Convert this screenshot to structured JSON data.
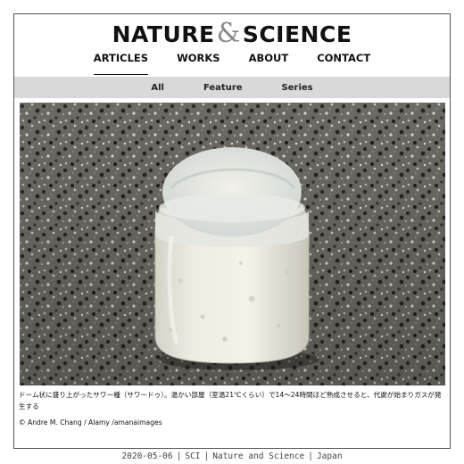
{
  "brand": {
    "left": "NATURE",
    "amp": "&",
    "right": "SCIENCE"
  },
  "main_nav": {
    "items": [
      {
        "label": "ARTICLES",
        "active": true
      },
      {
        "label": "WORKS",
        "active": false
      },
      {
        "label": "ABOUT",
        "active": false
      },
      {
        "label": "CONTACT",
        "active": false
      }
    ]
  },
  "sub_nav": {
    "items": [
      {
        "label": "All"
      },
      {
        "label": "Feature"
      },
      {
        "label": "Series"
      }
    ]
  },
  "article": {
    "image_subject": "sourdough starter in glass jar on granite countertop",
    "caption": "ドーム状に盛り上がったサワー種（サワードゥ）。温かい部屋（室温21℃くらい）で14〜24時間ほど熟成させると、代謝が始まりガスが発生する",
    "credit": "© Andre M. Chang / Alamy /amanaimages"
  },
  "footer": {
    "date": "2020-05-06",
    "tag": "SCI",
    "site": "Nature and Science",
    "region": "Japan"
  },
  "colors": {
    "subnav_bg": "#d9d9d9",
    "amp": "#8a8a8a",
    "frame_border": "#555555"
  }
}
